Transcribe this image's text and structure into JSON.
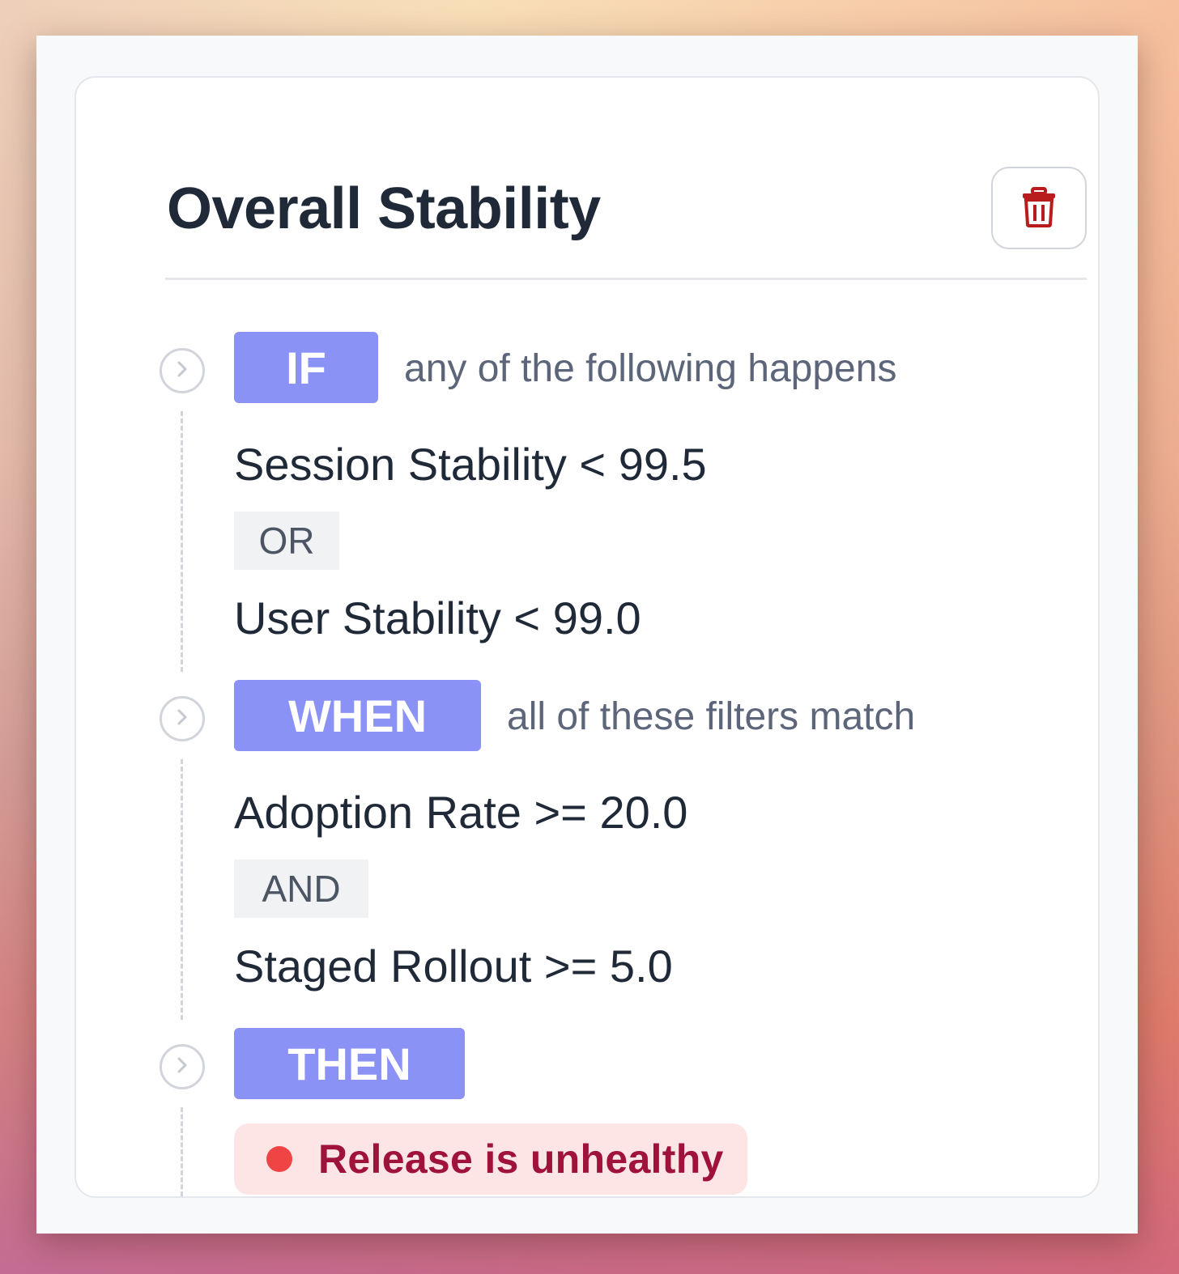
{
  "card": {
    "title": "Overall Stability",
    "delete_icon": "trash-icon"
  },
  "colors": {
    "tag_background": "#8a92f5",
    "delete_icon": "#b91c1c",
    "outcome_background": "#fde5e6",
    "outcome_text": "#9f1239",
    "outcome_dot": "#ef4444"
  },
  "if_section": {
    "tag": "IF",
    "hint": "any of the following happens",
    "conditions": [
      "Session Stability < 99.5",
      "User Stability < 99.0"
    ],
    "joiner": "OR"
  },
  "when_section": {
    "tag": "WHEN",
    "hint": "all of these filters match",
    "conditions": [
      "Adoption Rate >= 20.0",
      "Staged Rollout >= 5.0"
    ],
    "joiner": "AND"
  },
  "then_section": {
    "tag": "THEN",
    "outcome": "Release is unhealthy"
  },
  "step_icon": "chevron-right-circle-icon"
}
